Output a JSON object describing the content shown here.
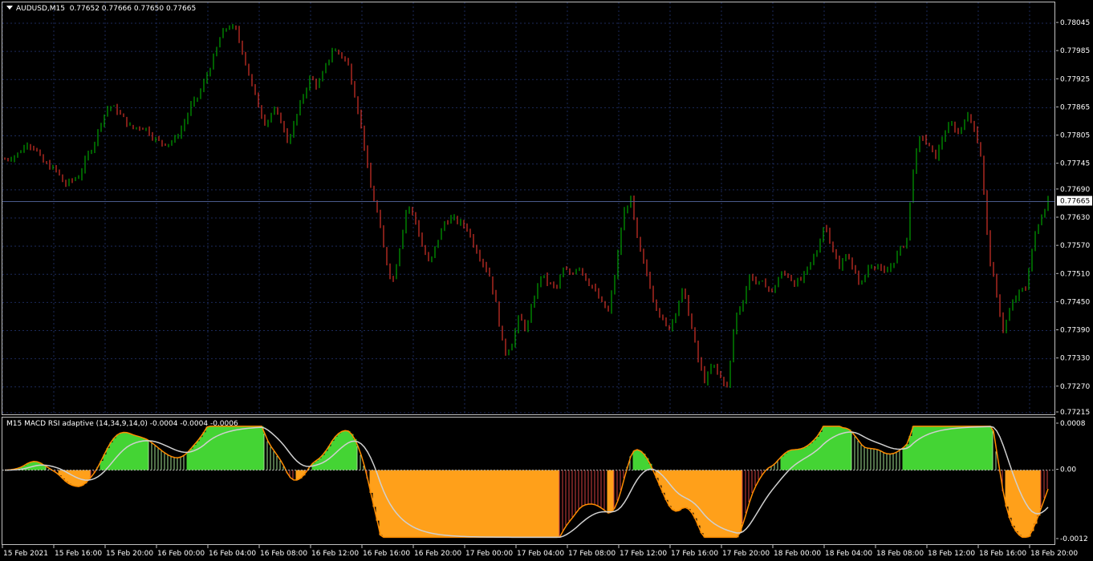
{
  "main": {
    "symbol": "AUDUSD,M15",
    "ohlc": "0.77652 0.77666 0.77650 0.77665",
    "current_price": "0.77665",
    "price_min": 0.77215,
    "price_max": 0.78045,
    "price_ticks": [
      "0.78045",
      "0.77985",
      "0.77925",
      "0.77865",
      "0.77805",
      "0.77745",
      "0.77690",
      "0.77630",
      "0.77570",
      "0.77510",
      "0.77450",
      "0.77390",
      "0.77330",
      "0.77270",
      "0.77215"
    ],
    "up_color": "#00c000",
    "down_color": "#ff3b30",
    "price_line_color": "#4a5a8a",
    "close_series": [
      0.77755,
      0.7776,
      0.7777,
      0.7779,
      0.7778,
      0.7775,
      0.7774,
      0.7773,
      0.777,
      0.7771,
      0.7772,
      0.7776,
      0.7779,
      0.7784,
      0.7787,
      0.7786,
      0.7784,
      0.7782,
      0.77825,
      0.7782,
      0.778,
      0.7779,
      0.7779,
      0.778,
      0.7783,
      0.7787,
      0.7789,
      0.7793,
      0.7797,
      0.7802,
      0.7804,
      0.7803,
      0.7798,
      0.7792,
      0.7787,
      0.7783,
      0.7786,
      0.7784,
      0.7779,
      0.7784,
      0.7789,
      0.7793,
      0.7791,
      0.7795,
      0.7799,
      0.7798,
      0.7796,
      0.7789,
      0.7781,
      0.777,
      0.7764,
      0.7755,
      0.7749,
      0.7757,
      0.7766,
      0.7763,
      0.7757,
      0.7753,
      0.7758,
      0.7762,
      0.7763,
      0.7762,
      0.7761,
      0.7757,
      0.7754,
      0.7751,
      0.7744,
      0.7734,
      0.7736,
      0.7742,
      0.7739,
      0.7746,
      0.7751,
      0.7749,
      0.7748,
      0.7752,
      0.7751,
      0.7753,
      0.775,
      0.7748,
      0.7745,
      0.7743,
      0.7752,
      0.7764,
      0.7767,
      0.7757,
      0.7752,
      0.7746,
      0.7742,
      0.7739,
      0.7743,
      0.7748,
      0.7741,
      0.7733,
      0.7728,
      0.7732,
      0.7729,
      0.7727,
      0.7742,
      0.7745,
      0.7751,
      0.7749,
      0.7749,
      0.7747,
      0.7751,
      0.7751,
      0.7749,
      0.775,
      0.7753,
      0.7756,
      0.7762,
      0.7757,
      0.7752,
      0.7756,
      0.7751,
      0.7749,
      0.7753,
      0.7753,
      0.7751,
      0.7753,
      0.7756,
      0.7758,
      0.7775,
      0.7781,
      0.7778,
      0.7776,
      0.7781,
      0.7783,
      0.7781,
      0.7785,
      0.7783,
      0.7776,
      0.7756,
      0.7747,
      0.7739,
      0.7744,
      0.7747,
      0.7748,
      0.7758,
      0.7763,
      0.7767
    ]
  },
  "osc": {
    "title": "M15 MACD RSI adaptive (14,34,9,14,0) -0.0004 -0.0004 -0.0006",
    "y_min": -0.0012,
    "y_max": 0.0008,
    "ticks": [
      "0.0008",
      "0.00",
      "-0.0012"
    ],
    "zero_label": "0.00",
    "up_color": "#44d434",
    "down_color": "#ffa01a",
    "signal_up_color": "#44d434",
    "signal_down_color": "#ff8c00",
    "avg_color": "#d0d0d0"
  },
  "time_axis": [
    "15 Feb 2021",
    "15 Feb 16:00",
    "15 Feb 20:00",
    "16 Feb 00:00",
    "16 Feb 04:00",
    "16 Feb 08:00",
    "16 Feb 12:00",
    "16 Feb 16:00",
    "16 Feb 20:00",
    "17 Feb 00:00",
    "17 Feb 04:00",
    "17 Feb 08:00",
    "17 Feb 12:00",
    "17 Feb 16:00",
    "17 Feb 20:00",
    "18 Feb 00:00",
    "18 Feb 04:00",
    "18 Feb 08:00",
    "18 Feb 12:00",
    "18 Feb 16:00",
    "18 Feb 20:00"
  ]
}
